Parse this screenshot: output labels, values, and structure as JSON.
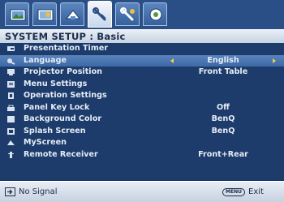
{
  "tabs": [
    {
      "icon": "picture-icon",
      "active": false
    },
    {
      "icon": "picture-advanced-icon",
      "active": false
    },
    {
      "icon": "display-icon",
      "active": false
    },
    {
      "icon": "system-setup-basic-icon",
      "active": true
    },
    {
      "icon": "system-setup-advanced-icon",
      "active": false
    },
    {
      "icon": "information-icon",
      "active": false
    }
  ],
  "header": {
    "title": "SYSTEM SETUP : Basic"
  },
  "menu": {
    "items": [
      {
        "label": "Presentation Timer",
        "value": "",
        "icon": "timer-icon"
      },
      {
        "label": "Language",
        "value": "English",
        "icon": "language-icon",
        "highlighted": true
      },
      {
        "label": "Projector Position",
        "value": "Front Table",
        "icon": "projector-position-icon"
      },
      {
        "label": "Menu Settings",
        "value": "",
        "icon": "menu-settings-icon"
      },
      {
        "label": "Operation Settings",
        "value": "",
        "icon": "operation-settings-icon"
      },
      {
        "label": "Panel Key Lock",
        "value": "Off",
        "icon": "lock-icon"
      },
      {
        "label": "Background Color",
        "value": "BenQ",
        "icon": "background-color-icon"
      },
      {
        "label": "Splash Screen",
        "value": "BenQ",
        "icon": "splash-screen-icon"
      },
      {
        "label": "MyScreen",
        "value": "",
        "icon": "myscreen-icon"
      },
      {
        "label": "Remote Receiver",
        "value": "Front+Rear",
        "icon": "remote-receiver-icon"
      }
    ]
  },
  "status": {
    "signal_text": "No Signal",
    "menu_key": "MENU",
    "exit_label": "Exit"
  },
  "colors": {
    "highlight": "#4a77b1",
    "background": "#1d3c6b",
    "arrow": "#f2d04a"
  }
}
